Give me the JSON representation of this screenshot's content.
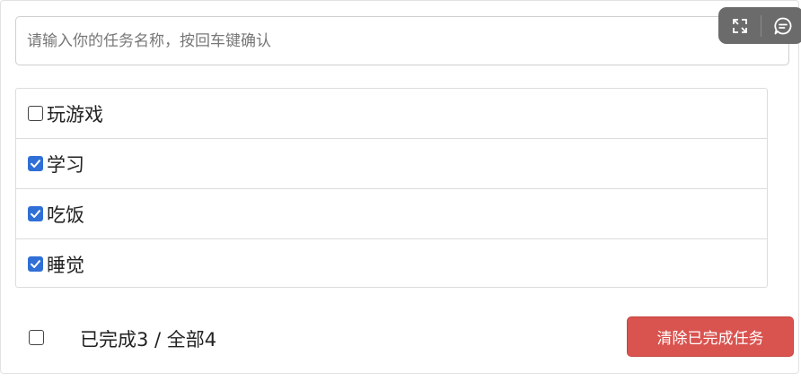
{
  "header": {
    "input_value": "",
    "input_placeholder": "请输入你的任务名称，按回车键确认"
  },
  "toolbar": {
    "buttons": [
      {
        "icon": "expand-icon"
      },
      {
        "icon": "comment-icon"
      }
    ]
  },
  "tasks": [
    {
      "label": "玩游戏",
      "done": false
    },
    {
      "label": "学习",
      "done": true
    },
    {
      "label": "吃饭",
      "done": true
    },
    {
      "label": "睡觉",
      "done": true
    }
  ],
  "footer": {
    "check_all": false,
    "status_text": "已完成3 / 全部4",
    "clear_button_label": "清除已完成任务"
  },
  "colors": {
    "accent": "#2f6fd6",
    "danger": "#d9534f"
  }
}
